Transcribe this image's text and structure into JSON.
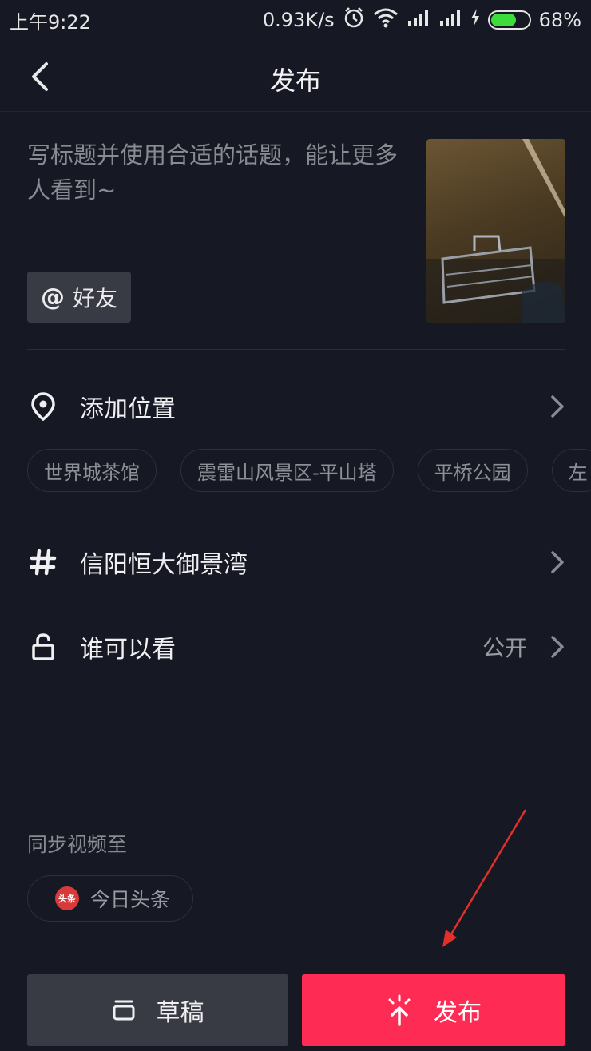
{
  "status_bar": {
    "time": "上午9:22",
    "net_speed": "0.93K/s",
    "battery_percent": "68%",
    "battery_level": 0.68
  },
  "header": {
    "title": "发布"
  },
  "post": {
    "caption_placeholder": "写标题并使用合适的话题，能让更多人看到~",
    "mention_label": "好友",
    "mention_symbol": "@"
  },
  "location": {
    "label": "添加位置",
    "suggestions": [
      "世界城茶馆",
      "震雷山风景区-平山塔",
      "平桥公园",
      "左"
    ]
  },
  "topic": {
    "label": "信阳恒大御景湾"
  },
  "visibility": {
    "label": "谁可以看",
    "value": "公开"
  },
  "sync": {
    "label": "同步视频至",
    "target": "今日头条",
    "target_logo_text": "头条"
  },
  "actions": {
    "draft_label": "草稿",
    "publish_label": "发布"
  },
  "colors": {
    "background": "#161823",
    "accent": "#fe2c55",
    "secondary_button": "#393b44",
    "annotation_arrow": "#e0302a"
  }
}
